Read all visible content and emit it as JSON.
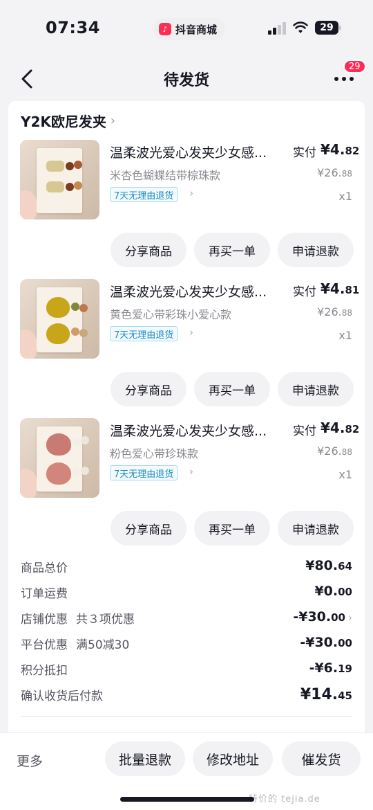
{
  "status_bar": {
    "time": "07:34",
    "app_name": "抖音商城",
    "battery": "29"
  },
  "nav": {
    "title": "待发货",
    "more_badge": "29"
  },
  "shop": {
    "name": "Y2K欧尼发夹"
  },
  "items": [
    {
      "title": "温柔波光爱心发夹少女感...",
      "paid_label": "实付",
      "paid_int": "¥4.",
      "paid_dec": "82",
      "spec": "米杏色蝴蝶结带棕珠款",
      "orig_int": "¥26.",
      "orig_dec": "88",
      "tag": "7天无理由退货",
      "qty": "x1",
      "buttons": [
        "分享商品",
        "再买一单",
        "申请退款"
      ]
    },
    {
      "title": "温柔波光爱心发夹少女感...",
      "paid_label": "实付",
      "paid_int": "¥4.",
      "paid_dec": "81",
      "spec": "黄色爱心带彩珠小爱心款",
      "orig_int": "¥26.",
      "orig_dec": "88",
      "tag": "7天无理由退货",
      "qty": "x1",
      "buttons": [
        "分享商品",
        "再买一单",
        "申请退款"
      ]
    },
    {
      "title": "温柔波光爱心发夹少女感...",
      "paid_label": "实付",
      "paid_int": "¥4.",
      "paid_dec": "82",
      "spec": "粉色爱心带珍珠款",
      "orig_int": "¥26.",
      "orig_dec": "88",
      "tag": "7天无理由退货",
      "qty": "x1",
      "buttons": [
        "分享商品",
        "再买一单",
        "申请退款"
      ]
    }
  ],
  "summary": [
    {
      "label": "商品总价",
      "sub": "",
      "int": "¥80.",
      "dec": "64"
    },
    {
      "label": "订单运费",
      "sub": "",
      "int": "¥0.",
      "dec": "00"
    },
    {
      "label": "店铺优惠",
      "sub": "共３项优惠",
      "int": "-¥30.",
      "dec": "00"
    },
    {
      "label": "平台优惠",
      "sub": "满50减30",
      "int": "-¥30.",
      "dec": "00"
    },
    {
      "label": "积分抵扣",
      "sub": "",
      "int": "-¥6.",
      "dec": "19"
    },
    {
      "label": "确认收货后付款",
      "sub": "",
      "int": "¥14.",
      "dec": "45"
    }
  ],
  "bottom_bar": {
    "more": "更多",
    "batch_refund": "批量退款",
    "change_address": "修改地址",
    "urge_shipping": "催发货",
    "watermark": "特价的 tejia.de"
  },
  "colors": {
    "accent": "#fe2c55",
    "tag_blue": "#1a8bc1"
  }
}
